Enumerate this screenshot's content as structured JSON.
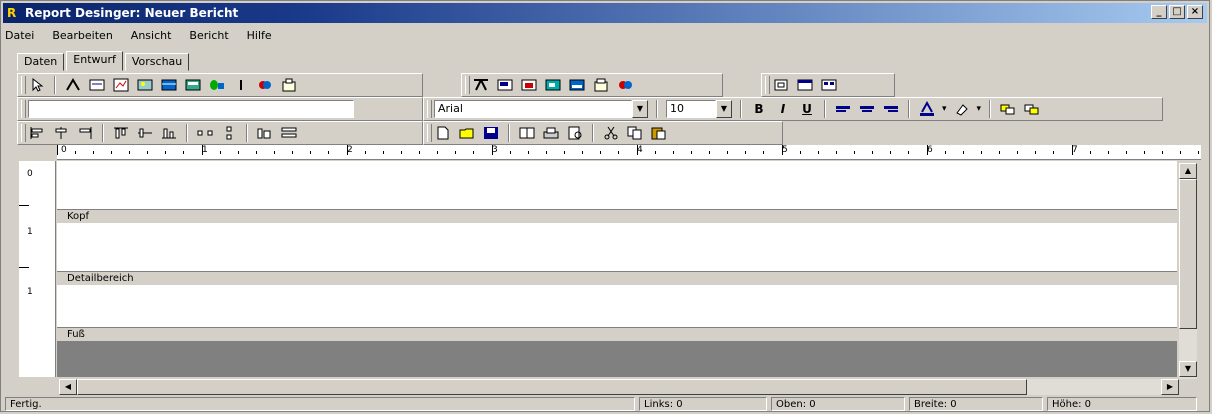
{
  "window": {
    "title": "Report Desinger: Neuer Bericht",
    "controls": [
      "_",
      "□",
      "×"
    ]
  },
  "menu": [
    "Datei",
    "Bearbeiten",
    "Ansicht",
    "Bericht",
    "Hilfe"
  ],
  "tabs": [
    "Daten",
    "Entwurf",
    "Vorschau"
  ],
  "toolbar": {
    "font_name": "Arial",
    "font_size": "10",
    "bold": "B",
    "italic": "I",
    "underline": "U"
  },
  "ruler": {
    "numbers": [
      "0",
      "1",
      "2",
      "3",
      "4",
      "5",
      "6",
      "7"
    ]
  },
  "left_ruler": [
    "0",
    "1",
    "1"
  ],
  "bands": {
    "header": "Kopf",
    "detail": "Detailbereich",
    "footer": "Fuß"
  },
  "status": {
    "ready": "Fertig.",
    "left": "Links: 0",
    "top": "Oben: 0",
    "width": "Breite: 0",
    "height": "Höhe: 0"
  }
}
